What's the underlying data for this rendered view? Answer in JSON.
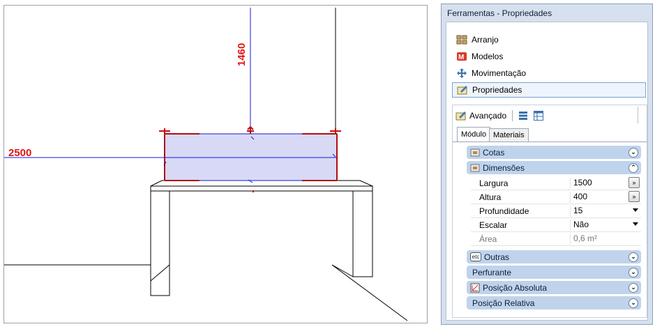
{
  "viewport": {
    "dim_horizontal": "2500",
    "dim_vertical": "1460"
  },
  "panel": {
    "title": "Ferramentas - Propriedades",
    "nav": [
      "Arranjo",
      "Modelos",
      "Movimentação",
      "Propriedades"
    ],
    "advanced_label": "Avançado",
    "tabs": [
      "Módulo",
      "Materiais"
    ],
    "groups": {
      "cotas": "Cotas",
      "dimensoes": "Dimensões",
      "outras": "Outras",
      "perfurante": "Perfurante",
      "posicao_absoluta": "Posição Absoluta",
      "posicao_relativa": "Posição Relativa"
    },
    "properties": [
      {
        "name": "Largura",
        "value": "1500"
      },
      {
        "name": "Altura",
        "value": "400"
      },
      {
        "name": "Profundidade",
        "value": "15"
      },
      {
        "name": "Escalar",
        "value": "Não"
      },
      {
        "name": "Área",
        "value": "0,6 m²"
      }
    ],
    "expand_button": "»",
    "etc_icon_text": "etc"
  },
  "colors": {
    "dimension": "#e01515",
    "object_fill": "#d8d9f5",
    "group_header": "#bfd3ec"
  }
}
